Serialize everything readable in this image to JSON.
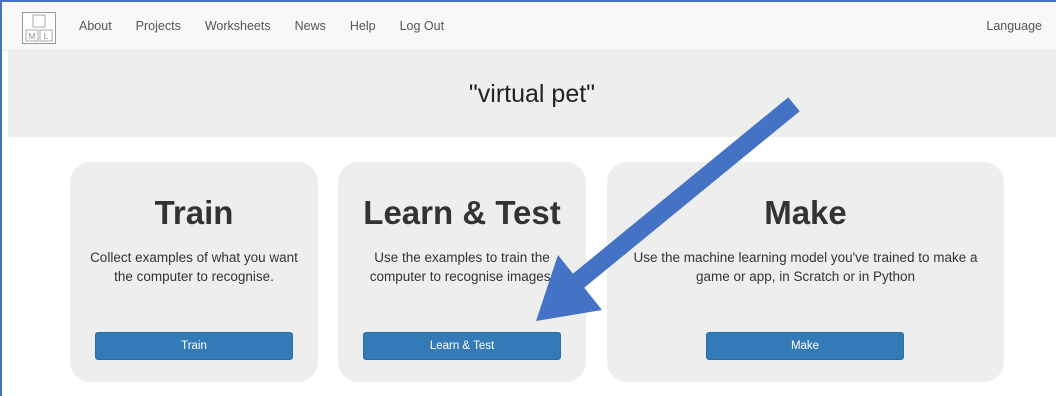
{
  "navbar": {
    "logo_letters": [
      "M",
      "L"
    ],
    "links": [
      "About",
      "Projects",
      "Worksheets",
      "News",
      "Help",
      "Log Out"
    ],
    "language": "Language"
  },
  "project": {
    "title": "\"virtual pet\""
  },
  "cards": [
    {
      "heading": "Train",
      "description": "Collect examples of what you want the computer to recognise.",
      "button": "Train"
    },
    {
      "heading": "Learn & Test",
      "description": "Use the examples to train the computer to recognise images.",
      "button": "Learn & Test"
    },
    {
      "heading": "Make",
      "description": "Use the machine learning model you've trained to make a game or app, in Scratch or in Python",
      "button": "Make"
    }
  ],
  "colors": {
    "button": "#337ab7",
    "card_background": "#eeeeee",
    "annotation_arrow": "#4472c4"
  },
  "annotation": {
    "icon": "arrow-pointing-to-learn-test-button"
  }
}
